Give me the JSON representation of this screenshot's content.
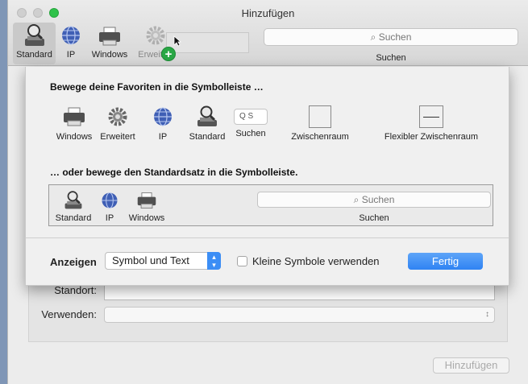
{
  "window": {
    "title": "Hinzufügen"
  },
  "toolbar": {
    "items": [
      {
        "label": "Standard",
        "icon": "standard-icon"
      },
      {
        "label": "IP",
        "icon": "globe-icon"
      },
      {
        "label": "Windows",
        "icon": "printer-icon"
      },
      {
        "label": "Erweitert",
        "icon": "gear-icon"
      }
    ],
    "search_placeholder": "Suchen",
    "search_label": "Suchen"
  },
  "customize": {
    "favorites_heading": "Bewege deine Favoriten in die Symbolleiste …",
    "favorites": [
      {
        "label": "Windows",
        "icon": "printer-icon"
      },
      {
        "label": "Erweitert",
        "icon": "gear-icon"
      },
      {
        "label": "IP",
        "icon": "globe-icon"
      },
      {
        "label": "Standard",
        "icon": "standard-icon"
      },
      {
        "label": "Suchen",
        "icon": "search-field-icon"
      },
      {
        "label": "Zwischenraum",
        "icon": "space-icon"
      },
      {
        "label": "Flexibler Zwischenraum",
        "icon": "flexible-space-icon"
      }
    ],
    "mini_search_text": "Q S",
    "default_heading": "… oder bewege den Standardsatz in die Symbolleiste.",
    "default_set": [
      {
        "label": "Standard",
        "icon": "standard-icon"
      },
      {
        "label": "IP",
        "icon": "globe-icon"
      },
      {
        "label": "Windows",
        "icon": "printer-icon"
      }
    ],
    "default_search_placeholder": "Suchen",
    "default_search_label": "Suchen",
    "show_label": "Anzeigen",
    "show_value": "Symbol und Text",
    "small_icons_label": "Kleine Symbole verwenden",
    "done_label": "Fertig"
  },
  "form": {
    "location_label": "Standort:",
    "use_label": "Verwenden:",
    "add_button": "Hinzufügen"
  },
  "colors": {
    "accent": "#3c8ef5",
    "desktop": "#7f96b6",
    "add_badge": "#29a745"
  }
}
